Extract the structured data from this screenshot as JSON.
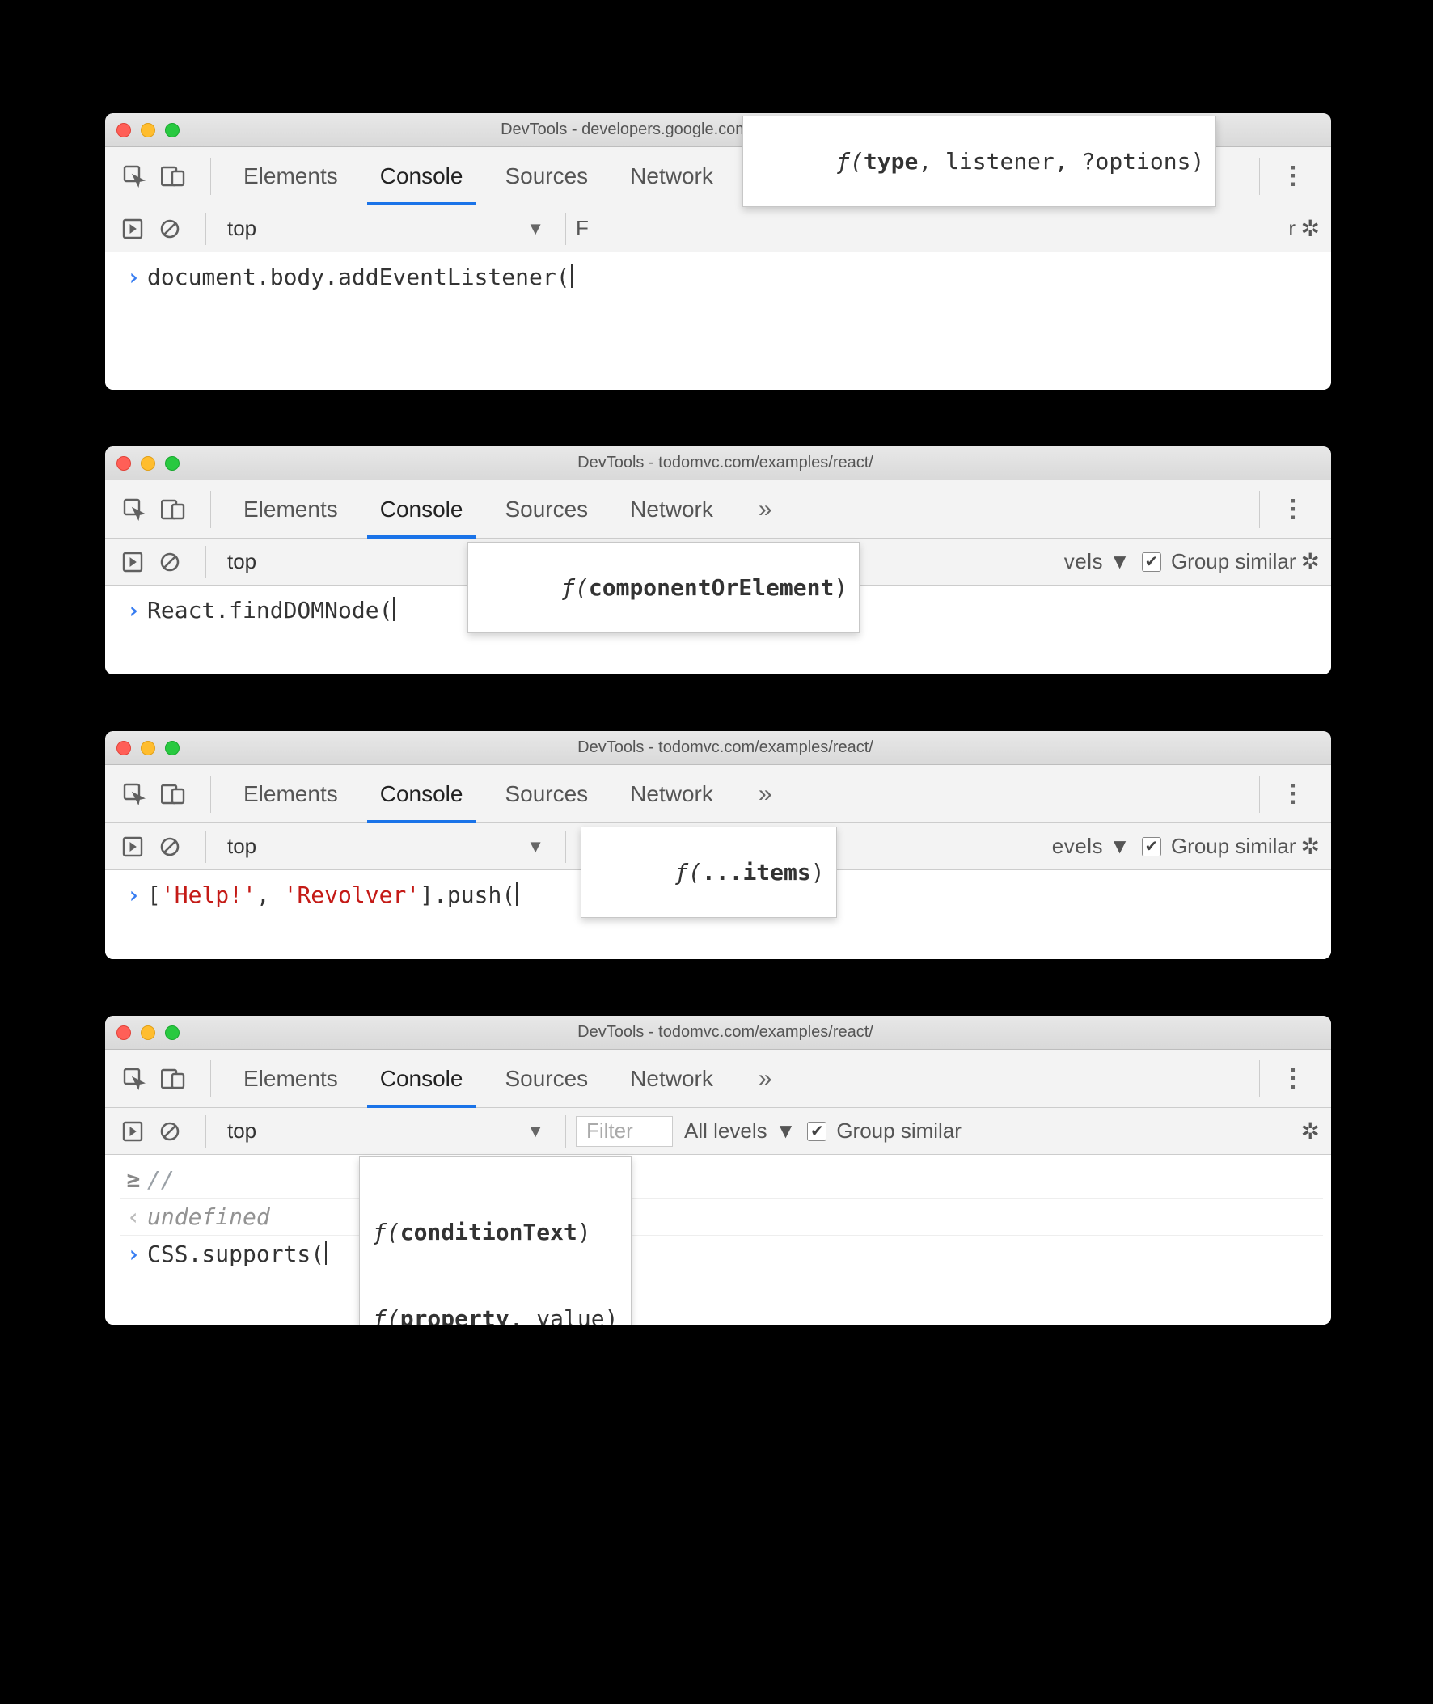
{
  "common": {
    "tabs": {
      "elements": "Elements",
      "console": "Console",
      "sources": "Sources",
      "network": "Network",
      "more": "»",
      "kebab": "⋮"
    },
    "toolbar": {
      "context": "top",
      "dropdown_glyph": "▼",
      "filter_placeholder": "Filter",
      "levels_label": "All levels",
      "levels_dd": "▼",
      "group_label": "Group similar",
      "group_checked": "✔"
    }
  },
  "panel1": {
    "title": "DevTools - developers.google.com/web/tools/chrome-devtools/",
    "code_pre": "document.body.addEventListener(",
    "right_partial_left": "F",
    "right_partial_right": "r",
    "sig": {
      "f": "ƒ(",
      "bold": "type",
      "rest": ", listener, ?options)"
    }
  },
  "panel2": {
    "title": "DevTools - todomvc.com/examples/react/",
    "code_pre": "React.findDOMNode(",
    "right_partial": "vels ▼",
    "sig": {
      "f": "ƒ(",
      "bold": "componentOrElement",
      "rest": ")"
    }
  },
  "panel3": {
    "title": "DevTools - todomvc.com/examples/react/",
    "code_pre_a": "[",
    "code_str1": "'Help!'",
    "code_mid": ", ",
    "code_str2": "'Revolver'",
    "code_pre_b": "].push(",
    "right_partial": "evels ▼",
    "sig": {
      "f": "ƒ(",
      "bold": "...items",
      "rest": ")"
    }
  },
  "panel4": {
    "title": "DevTools - todomvc.com/examples/react/",
    "line1_gutter": "≥",
    "line1_code": "//",
    "line2_gutter": "‹",
    "line2_code": "undefined",
    "code_pre": "CSS.supports(",
    "sig1": {
      "f": "ƒ(",
      "bold": "conditionText",
      "rest": ")"
    },
    "sig2": {
      "f": "ƒ(",
      "bold": "property",
      "rest": ", value)"
    }
  }
}
